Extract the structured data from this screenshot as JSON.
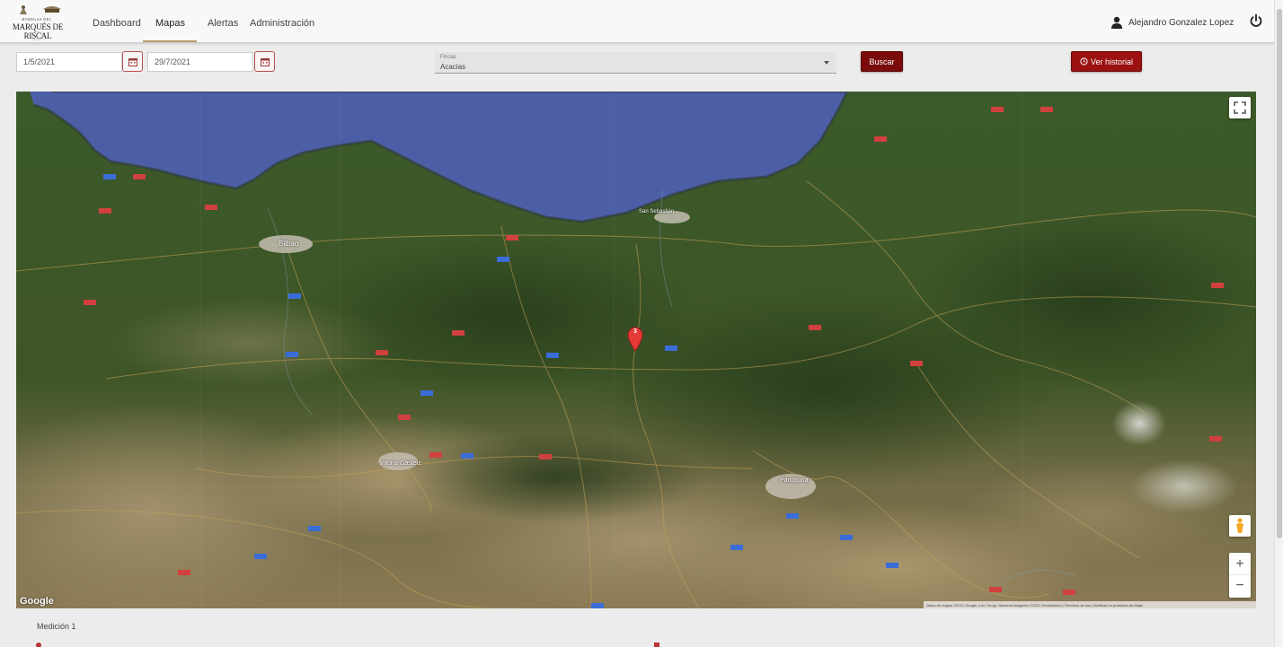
{
  "brand": {
    "top": "BODEGAS DEL",
    "main": "MARQUÉS DE RISCAL"
  },
  "nav": {
    "items": [
      {
        "label": "Dashboard"
      },
      {
        "label": "Mapas"
      },
      {
        "label": "Alertas"
      },
      {
        "label": "Administración"
      }
    ],
    "active": "Mapas",
    "user_name": "Alejandro Gonzalez Lopez"
  },
  "filters": {
    "date_from": "1/5/2021",
    "date_to": "29/7/2021",
    "select_label": "Fincas",
    "select_value": "Acacias",
    "search_button": "Buscar",
    "history_button": "Ver historial"
  },
  "map": {
    "type": "satellite",
    "marker_label": "3",
    "google_label": "Google",
    "attribution": "Datos de mapas ©2021 Google, Inst. Geogr. Nacional Imágenes ©2021 TerraMetrics | Términos de uso | Notificar un problema de Maps",
    "zoom_in": "+",
    "zoom_out": "−",
    "place_labels": [
      "Bilbao",
      "Vitoria-Gasteiz",
      "Pamplona",
      "San Sebastián"
    ],
    "colors": {
      "sea": "#4c5fa6",
      "forest": "#3a5226",
      "farmland": "#9a8a62",
      "marker": "#e53935"
    }
  },
  "bottom": {
    "section_title": "Medición 1"
  },
  "colors": {
    "primary": "#7a0c0c",
    "accent": "#9b1111",
    "nav_underline": "#b89a6a"
  }
}
